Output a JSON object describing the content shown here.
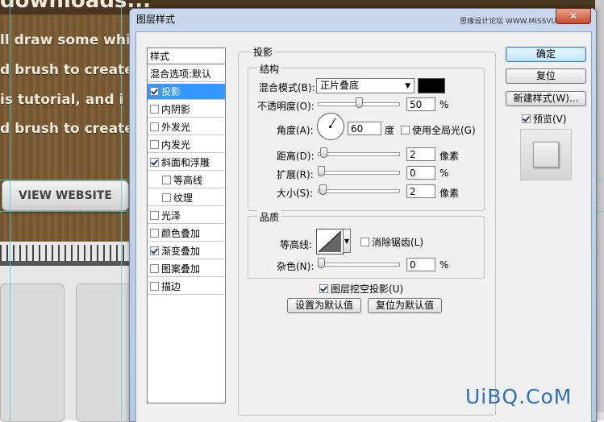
{
  "background_page": {
    "heading_fragment": "downloads...",
    "lines": [
      "ll draw some white",
      "d brush to create t",
      "is tutorial, and i wi",
      "d brush to create t"
    ],
    "view_button": "VIEW WEBSITE",
    "logo": "UiBQ.CoM"
  },
  "dialog": {
    "title": "图层样式",
    "close_label": "✕",
    "watermark": "思缘设计论坛 WWW.MISSVUAN.COM",
    "styles_list": {
      "header": "样式",
      "blend_defaults": "混合选项:默认",
      "items": [
        {
          "label": "投影",
          "checked": true,
          "selected": true
        },
        {
          "label": "内阴影",
          "checked": false
        },
        {
          "label": "外发光",
          "checked": false
        },
        {
          "label": "内发光",
          "checked": false
        },
        {
          "label": "斜面和浮雕",
          "checked": true
        },
        {
          "label": "等高线",
          "checked": false,
          "indent": true
        },
        {
          "label": "纹理",
          "checked": false,
          "indent": true
        },
        {
          "label": "光泽",
          "checked": false
        },
        {
          "label": "颜色叠加",
          "checked": false
        },
        {
          "label": "渐变叠加",
          "checked": true
        },
        {
          "label": "图案叠加",
          "checked": false
        },
        {
          "label": "描边",
          "checked": false
        }
      ]
    },
    "drop_shadow": {
      "section_title": "投影",
      "structure_title": "结构",
      "blend_mode_label": "混合模式(B):",
      "blend_mode_value": "正片叠底",
      "shadow_color": "#000000",
      "opacity_label": "不透明度(O):",
      "opacity_value": "50",
      "opacity_unit": "%",
      "opacity_fraction": 0.5,
      "angle_label": "角度(A):",
      "angle_value": "60",
      "angle_unit": "度",
      "global_light_label": "使用全局光(G)",
      "global_light_checked": false,
      "distance_label": "距离(D):",
      "distance_value": "2",
      "distance_unit": "像素",
      "spread_label": "扩展(R):",
      "spread_value": "0",
      "spread_unit": "%",
      "size_label": "大小(S):",
      "size_value": "2",
      "size_unit": "像素",
      "quality_title": "品质",
      "contour_label": "等高线:",
      "antialias_label": "消除锯齿(L)",
      "antialias_checked": false,
      "noise_label": "杂色(N):",
      "noise_value": "0",
      "noise_unit": "%",
      "knockout_label": "图层挖空投影(U)",
      "knockout_checked": true,
      "make_default_label": "设置为默认值",
      "reset_default_label": "复位为默认值"
    },
    "buttons": {
      "ok": "确定",
      "reset": "复位",
      "new_style": "新建样式(W)...",
      "preview_label": "预览(V)",
      "preview_checked": true
    }
  }
}
